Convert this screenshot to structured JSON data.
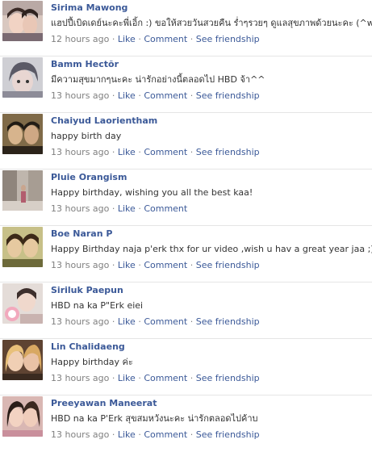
{
  "feed": {
    "posts": [
      {
        "name": "Sirima Mawong",
        "message": "แฮปปี้เบิดเดย์นะคะพี่เอิ้ก :) ขอให้สวยวันสวยคืน ร่ำๆรวยๆ ดูแลสุขภาพด้วยนะคะ (^w^)v",
        "time": "12 hours ago",
        "actions": [
          "Like",
          "Comment",
          "See friendship"
        ]
      },
      {
        "name": "Bamm Hectõr",
        "message": "มีความสุขมากๆนะคะ น่ารักอย่างนี้ตลอดไป HBD จ้า^^",
        "time": "13 hours ago",
        "actions": [
          "Like",
          "Comment",
          "See friendship"
        ]
      },
      {
        "name": "Chaiyud Laorientham",
        "message": "happy birth day",
        "time": "13 hours ago",
        "actions": [
          "Like",
          "Comment",
          "See friendship"
        ]
      },
      {
        "name": "Pluie Orangism",
        "message": "Happy birthday, wishing you all the best kaa!",
        "time": "13 hours ago",
        "actions": [
          "Like",
          "Comment"
        ]
      },
      {
        "name": "Boe Naran P",
        "message": "Happy Birthday naja p'erk thx for ur video ,wish u hav a great year jaa ;)",
        "time": "13 hours ago",
        "actions": [
          "Like",
          "Comment",
          "See friendship"
        ]
      },
      {
        "name": "Siriluk Paepun",
        "message": "HBD na ka P\"Erk eiei",
        "time": "13 hours ago",
        "actions": [
          "Like",
          "Comment",
          "See friendship"
        ]
      },
      {
        "name": "Lin Chalidaeng",
        "message": "Happy birthday ค่ะ",
        "time": "13 hours ago",
        "actions": [
          "Like",
          "Comment",
          "See friendship"
        ]
      },
      {
        "name": "Preeyawan Maneerat",
        "message": "HBD na ka P'Erk สุขสมหวังนะคะ น่ารักตลอดไปค้าบ",
        "time": "13 hours ago",
        "actions": [
          "Like",
          "Comment",
          "See friendship"
        ]
      }
    ]
  },
  "colors": {
    "link": "#3b5998",
    "meta_text": "#808080",
    "body_text": "#333333",
    "divider": "#e5e5e5"
  }
}
